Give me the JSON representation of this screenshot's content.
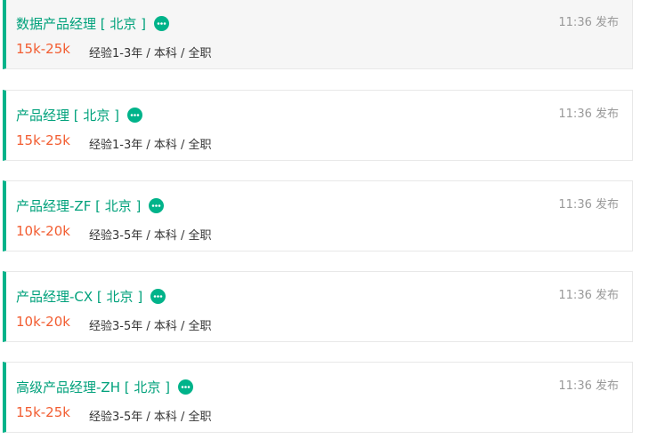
{
  "colors": {
    "accent": "#00b38a",
    "title": "#00a17b",
    "salary": "#f25d31",
    "muted": "#999999",
    "text": "#333333"
  },
  "jobs": [
    {
      "title": "数据产品经理 [ 北京 ]",
      "salary": "15k-25k",
      "requirements": "经验1-3年 / 本科 / 全职",
      "published": "11:36 发布",
      "chat_icon": "chat-bubble-icon",
      "active": true
    },
    {
      "title": "产品经理 [ 北京 ]",
      "salary": "15k-25k",
      "requirements": "经验1-3年 / 本科 / 全职",
      "published": "11:36 发布",
      "chat_icon": "chat-bubble-icon",
      "active": false
    },
    {
      "title": "产品经理-ZF [ 北京 ]",
      "salary": "10k-20k",
      "requirements": "经验3-5年 / 本科 / 全职",
      "published": "11:36 发布",
      "chat_icon": "chat-bubble-icon",
      "active": false
    },
    {
      "title": "产品经理-CX [ 北京 ]",
      "salary": "10k-20k",
      "requirements": "经验3-5年 / 本科 / 全职",
      "published": "11:36 发布",
      "chat_icon": "chat-bubble-icon",
      "active": false
    },
    {
      "title": "高级产品经理-ZH [ 北京 ]",
      "salary": "15k-25k",
      "requirements": "经验3-5年 / 本科 / 全职",
      "published": "11:36 发布",
      "chat_icon": "chat-bubble-icon",
      "active": false
    }
  ]
}
